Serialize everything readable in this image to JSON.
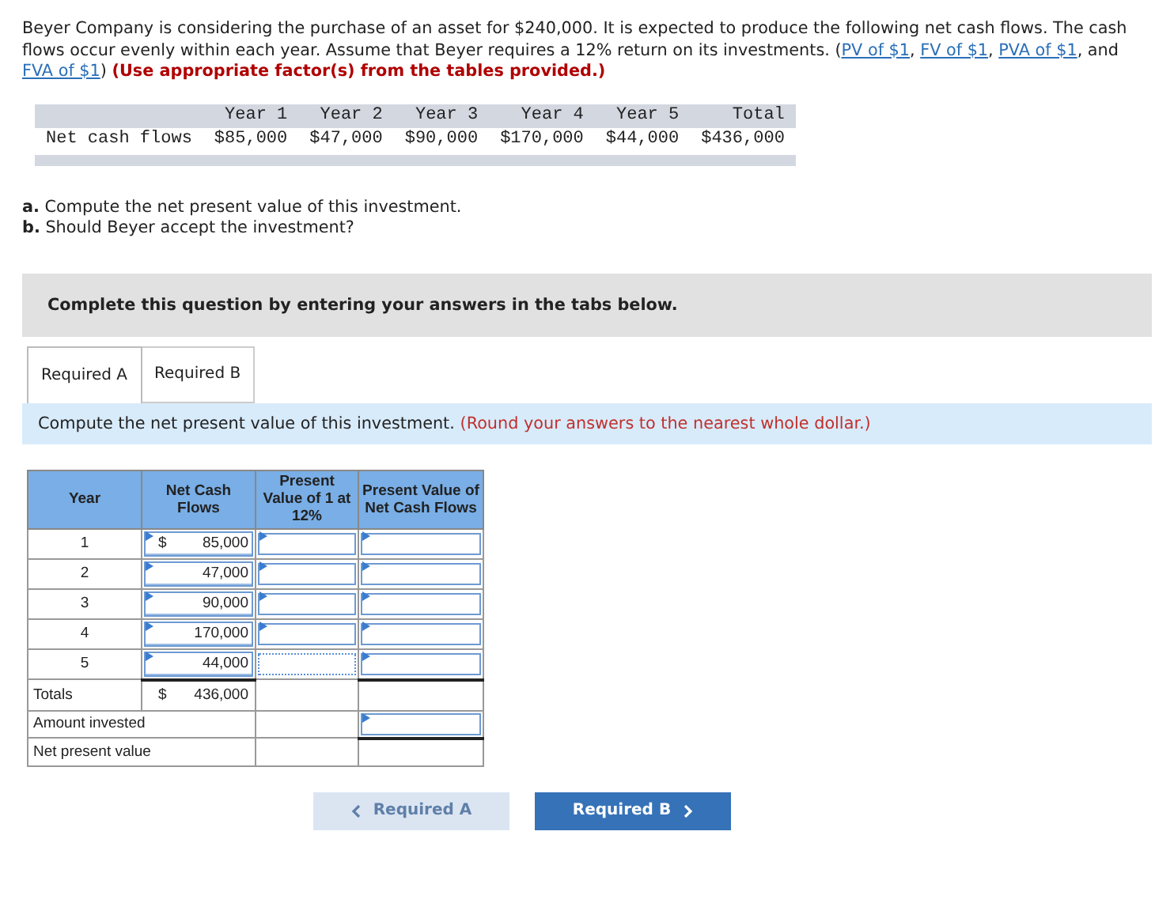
{
  "intro": [
    {
      "kind": "text",
      "text": "Beyer Company is considering the purchase of an asset for $240,000. It is expected to produce the following net cash flows. The cash flows occur evenly within each year. Assume that Beyer requires a 12% return on its investments. ("
    },
    {
      "kind": "link",
      "text": "PV of $1"
    },
    {
      "kind": "text",
      "text": ", "
    },
    {
      "kind": "link",
      "text": "FV of $1"
    },
    {
      "kind": "text",
      "text": ", "
    },
    {
      "kind": "link",
      "text": "PVA of $1"
    },
    {
      "kind": "text",
      "text": ", and "
    },
    {
      "kind": "link",
      "text": "FVA of $1"
    },
    {
      "kind": "text",
      "text": ") "
    },
    {
      "kind": "instruction",
      "text": "(Use appropriate factor(s) from the tables provided.)"
    }
  ],
  "cash_flow_table": {
    "columns": [
      "Year 1",
      "Year 2",
      "Year 3",
      "Year 4",
      "Year 5",
      "Total"
    ],
    "row": {
      "label": "Net cash flows",
      "values": [
        "$85,000",
        "$47,000",
        "$90,000",
        "$170,000",
        "$44,000",
        "$436,000"
      ]
    }
  },
  "questions": [
    "**a.** Compute the net present value of this investment.",
    "**b.** Should Beyer accept the investment?"
  ],
  "panel_title": "Complete this question by entering your answers in the tabs below.",
  "tabs": [
    {
      "label": "Required A",
      "selected": true
    },
    {
      "label": "Required B",
      "selected": false
    }
  ],
  "task": {
    "text": "Compute the net present value of this investment.",
    "note": "(Round your answers to the nearest whole dollar.)"
  },
  "answer_table": {
    "columns": [
      "Year",
      "Net Cash Flows",
      "Present Value of 1 at 12%",
      "Present Value of Net Cash Flows"
    ],
    "rows": [
      {
        "kind": "year",
        "label": "1",
        "currency": "$",
        "amount": "85,000",
        "pv_focused": false
      },
      {
        "kind": "year",
        "label": "2",
        "amount": "47,000",
        "pv_focused": false
      },
      {
        "kind": "year",
        "label": "3",
        "amount": "90,000",
        "pv_focused": false
      },
      {
        "kind": "year",
        "label": "4",
        "amount": "170,000",
        "pv_focused": false
      },
      {
        "kind": "year",
        "label": "5",
        "amount": "44,000",
        "pv_focused": true
      },
      {
        "kind": "totals",
        "label": "Totals",
        "currency": "$",
        "amount": "436,000"
      },
      {
        "kind": "invested",
        "label": "Amount invested"
      },
      {
        "kind": "npv",
        "label": "Net present value"
      }
    ]
  },
  "nav": [
    {
      "label": "Required A",
      "kind": "previous",
      "disabled": true
    },
    {
      "label": "Required B",
      "kind": "next",
      "disabled": false
    }
  ]
}
